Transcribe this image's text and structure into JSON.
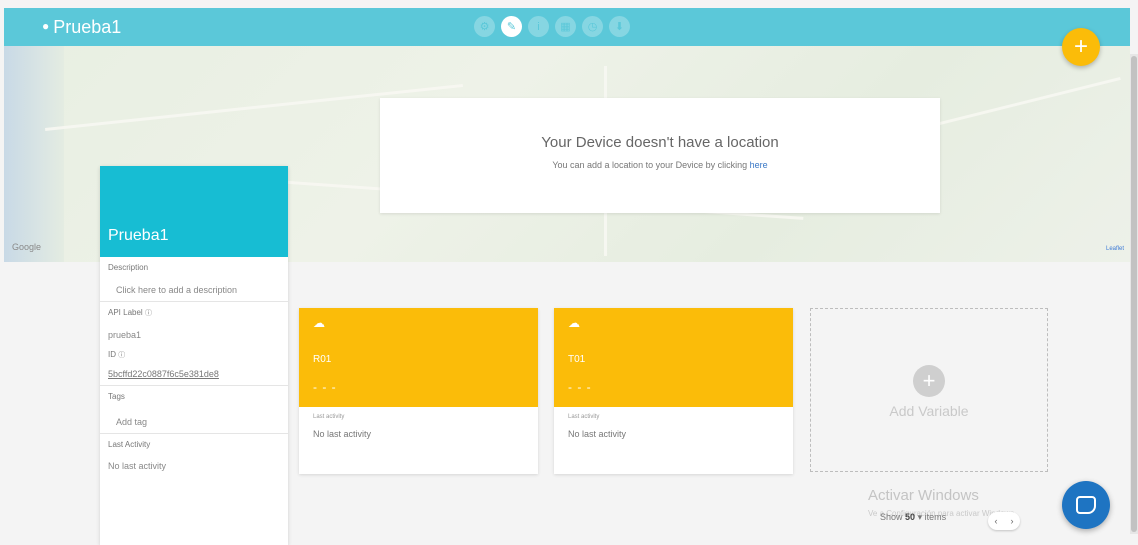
{
  "header": {
    "title": "Prueba1",
    "icons": [
      "settings-icon",
      "edit-icon",
      "info-icon",
      "widgets-icon",
      "events-icon",
      "download-icon"
    ]
  },
  "map": {
    "google_label": "Google",
    "attribution": "Leaflet"
  },
  "location_card": {
    "title": "Your Device doesn't have a location",
    "subtitle_prefix": "You can add a location to your Device by clicking",
    "subtitle_link": "here"
  },
  "device": {
    "name": "Prueba1",
    "description_label": "Description",
    "description_placeholder": "Click here to add a description",
    "api_label_label": "API Label",
    "api_label_value": "prueba1",
    "id_label": "ID",
    "id_value": "5bcffd22c0887f6c5e381de8",
    "tags_label": "Tags",
    "tags_placeholder": "Add tag",
    "last_activity_label": "Last Activity",
    "last_activity_value": "No last activity"
  },
  "variables": [
    {
      "name": "R01",
      "value": "- - -",
      "last_label": "Last activity",
      "last_value": "No last activity"
    },
    {
      "name": "T01",
      "value": "- - -",
      "last_label": "Last activity",
      "last_value": "No last activity"
    }
  ],
  "add_variable": {
    "label": "Add Variable"
  },
  "footer": {
    "watermark": "Activar Windows",
    "watermark_sub": "Ve a Configuración para activar Windows.",
    "show_prefix": "Show",
    "show_count": "50",
    "show_suffix": "items"
  },
  "colors": {
    "header": "#5bc8d9",
    "device_header": "#17bdd3",
    "variable_card": "#fbbc09",
    "fab": "#fbbc09",
    "chat": "#1e74c2"
  }
}
